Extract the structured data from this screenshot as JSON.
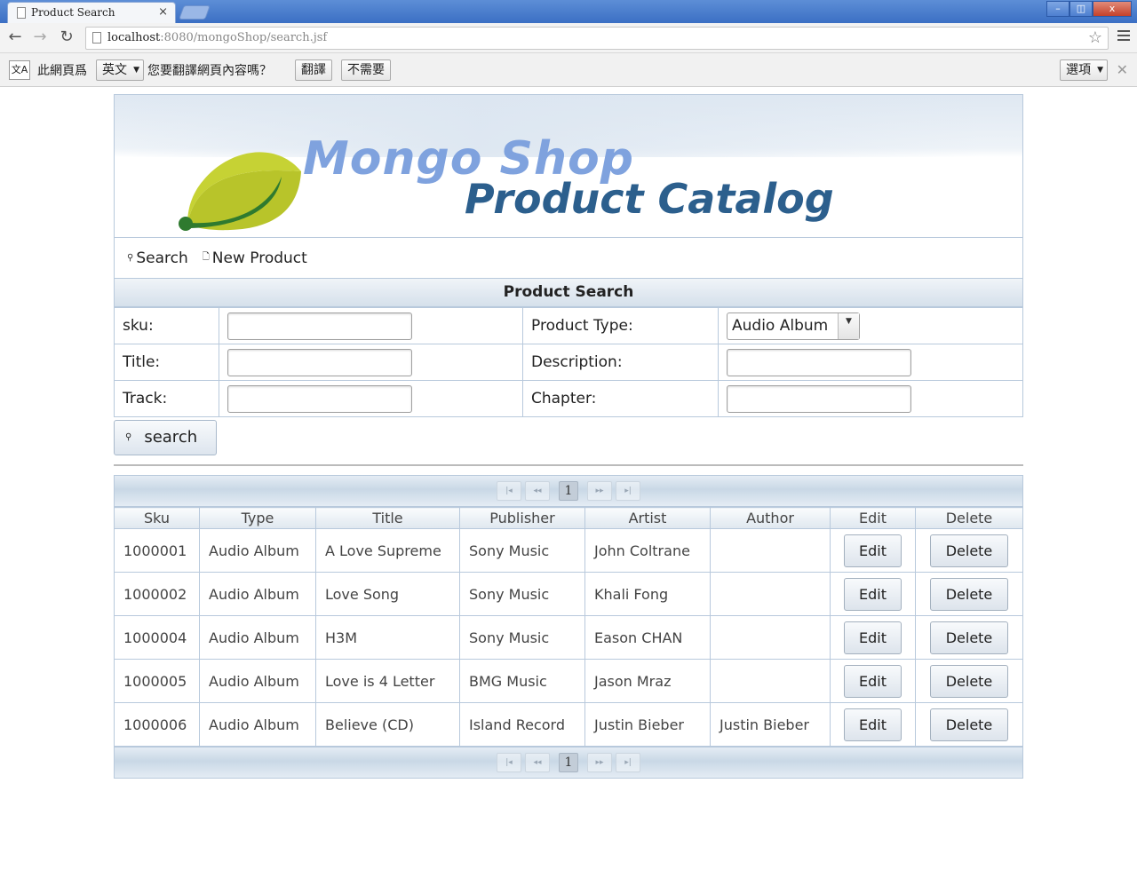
{
  "browser": {
    "tab_title": "Product Search",
    "tab_close": "×",
    "url_host": "localhost",
    "url_rest": ":8080/mongoShop/search.jsf",
    "win_min": "–",
    "win_max": "◫",
    "win_close": "x"
  },
  "translate_bar": {
    "icon": "文A",
    "prefix": "此網頁爲",
    "language": "英文",
    "question": "您要翻譯網頁內容嗎？",
    "translate_button": "翻譯",
    "no_button": "不需要",
    "options_button": "選項"
  },
  "header": {
    "brand_line1": "Mongo Shop",
    "brand_line2": "Product Catalog"
  },
  "menu": {
    "items": [
      {
        "label": "Search",
        "icon": "search-icon"
      },
      {
        "label": "New Product",
        "icon": "document-icon"
      }
    ]
  },
  "search_form": {
    "title": "Product Search",
    "sku_label": "sku:",
    "sku_value": "",
    "product_type_label": "Product Type:",
    "product_type_value": "Audio Album",
    "title_label": "Title:",
    "title_value": "",
    "description_label": "Description:",
    "description_value": "",
    "track_label": "Track:",
    "track_value": "",
    "chapter_label": "Chapter:",
    "chapter_value": "",
    "search_button": "search"
  },
  "paginator": {
    "first": "|◂",
    "prev": "◂◂",
    "page": "1",
    "next": "▸▸",
    "last": "▸|"
  },
  "results": {
    "columns": [
      "Sku",
      "Type",
      "Title",
      "Publisher",
      "Artist",
      "Author",
      "Edit",
      "Delete"
    ],
    "edit_label": "Edit",
    "delete_label": "Delete",
    "rows": [
      [
        "1000001",
        "Audio Album",
        "A Love Supreme",
        "Sony Music",
        "John Coltrane",
        ""
      ],
      [
        "1000002",
        "Audio Album",
        "Love Song",
        "Sony Music",
        "Khali Fong",
        ""
      ],
      [
        "1000004",
        "Audio Album",
        "H3M",
        "Sony Music",
        "Eason CHAN",
        ""
      ],
      [
        "1000005",
        "Audio Album",
        "Love is 4 Letter",
        "BMG Music",
        "Jason Mraz",
        ""
      ],
      [
        "1000006",
        "Audio Album",
        "Believe (CD)",
        "Island Record",
        "Justin Bieber",
        "Justin Bieber"
      ]
    ]
  }
}
